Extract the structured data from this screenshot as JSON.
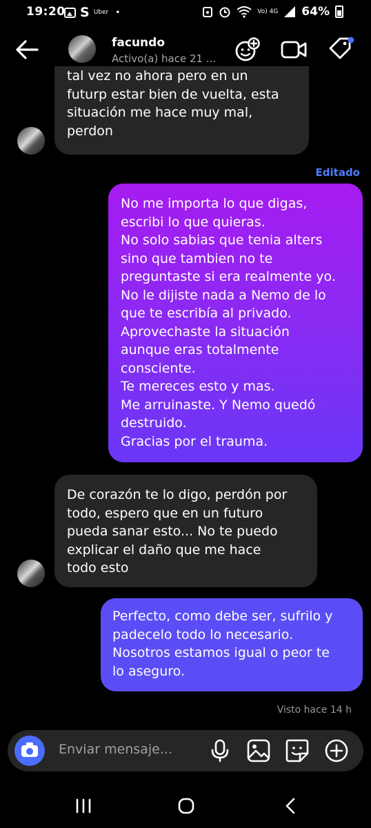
{
  "status_bar": {
    "time": "19:20",
    "carrier_glyph": "S",
    "app_label": "Uber",
    "dot": "•",
    "network": "Vo) 4G",
    "battery": "64%"
  },
  "header": {
    "contact_name": "facundo",
    "contact_status": "Activo(a) hace 21 ...",
    "icons": [
      "back-arrow-icon",
      "effects-icon",
      "video-call-icon",
      "tag-icon"
    ]
  },
  "messages": [
    {
      "direction": "incoming",
      "lines": [
        "tal vez no ahora pero en un",
        "futurp estar bien de vuelta, esta",
        "situación me hace muy mal,",
        "perdon"
      ]
    },
    {
      "direction": "outgoing",
      "edited_label": "Editado",
      "lines": [
        "No me importa lo que digas,",
        "escribi lo que quieras.",
        "No solo sabias que tenia alters",
        "sino que tambien no te",
        "preguntaste si era realmente yo.",
        "No le dijiste nada a Nemo de lo",
        "que te escribía al privado.",
        "Aprovechaste la situación",
        "aunque eras totalmente",
        "consciente.",
        "Te mereces esto y mas.",
        "Me arruinaste. Y Nemo quedó",
        "destruido.",
        "Gracias por el trauma."
      ]
    },
    {
      "direction": "incoming",
      "lines": [
        "De corazón te lo digo, perdón por",
        "todo, espero que en un futuro",
        "pueda sanar esto... No te puedo",
        "explicar el daño que me hace",
        "todo esto"
      ]
    },
    {
      "direction": "outgoing",
      "lines": [
        "Perfecto, como debe ser, sufrilo y",
        "padecelo todo lo necesario.",
        "Nosotros estamos igual o peor te",
        "lo aseguro."
      ]
    }
  ],
  "seen_label": "Visto hace 14 h",
  "composer": {
    "placeholder": "Enviar mensaje...",
    "icons": [
      "camera-icon",
      "microphone-icon",
      "gallery-icon",
      "sticker-icon",
      "add-icon"
    ]
  },
  "nav_bar": {
    "icons": [
      "recent-apps-icon",
      "home-icon",
      "back-icon"
    ]
  },
  "colors": {
    "incoming_bubble": "#262626",
    "outgoing_gradient_top": "#a61bf0",
    "outgoing_gradient_bottom": "#6a37f6",
    "outgoing_last": "#5b4df5",
    "accent": "#4b6cff"
  }
}
